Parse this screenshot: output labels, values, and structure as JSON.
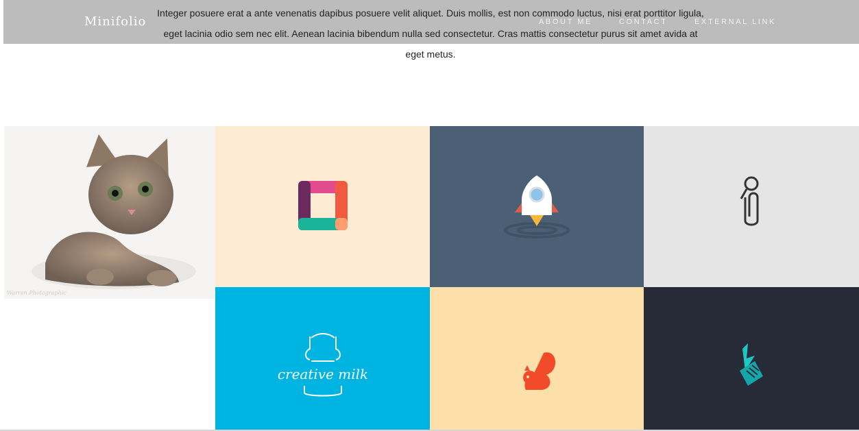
{
  "header": {
    "brand": "Minifolio",
    "nav": [
      "About me",
      "Contact",
      "External link"
    ]
  },
  "intro": {
    "paragraph": "Integer posuere erat a ante venenatis dapibus posuere velit aliquet. Duis mollis, est non commodo luctus, nisi erat porttitor ligula, eget lacinia odio sem nec elit. Aenean lacinia bibendum nulla sed consectetur. Cras mattis consectetur purus sit amet avida at eget metus."
  },
  "portfolio": {
    "tiles": [
      {
        "icon": "kitten-photo",
        "color": "#f6f4f2",
        "watermark": "Warren Photographic"
      },
      {
        "icon": "rounded-square-logo",
        "color": "#fdebd4"
      },
      {
        "icon": "rocket-logo",
        "color": "#4b6075"
      },
      {
        "icon": "paperclip-magnifier-logo",
        "color": "#e5e5e5"
      },
      {
        "icon": "blank-tile",
        "color": "#ffffff"
      },
      {
        "icon": "creative-milk-logo",
        "color": "#00b4e1",
        "label": "creative milk"
      },
      {
        "icon": "squirrel-logo",
        "color": "#fde0a9"
      },
      {
        "icon": "bolt-tag-logo",
        "color": "#272b38"
      }
    ]
  }
}
